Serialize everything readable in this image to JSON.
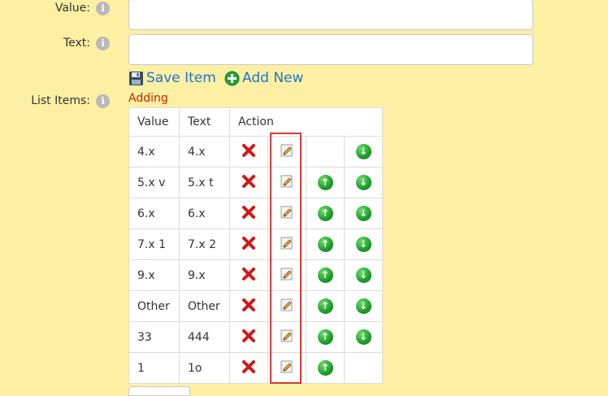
{
  "form": {
    "value_label": "Value:",
    "text_label": "Text:",
    "list_items_label": "List Items:",
    "info_glyph": "i",
    "value_input": "",
    "text_input": ""
  },
  "actions": {
    "save_item": "Save Item",
    "add_new": "Add New"
  },
  "status": "Adding",
  "table": {
    "headers": [
      "Value",
      "Text",
      "Action"
    ],
    "rows": [
      {
        "value": "4.x",
        "text": "4.x",
        "up": false,
        "down": true
      },
      {
        "value": "5.x v",
        "text": "5.x t",
        "up": true,
        "down": true
      },
      {
        "value": "6.x",
        "text": "6.x",
        "up": true,
        "down": true
      },
      {
        "value": "7.x 1",
        "text": "7.x 2",
        "up": true,
        "down": true
      },
      {
        "value": "9.x",
        "text": "9.x",
        "up": true,
        "down": true
      },
      {
        "value": "Other",
        "text": "Other",
        "up": true,
        "down": true
      },
      {
        "value": "33",
        "text": "444",
        "up": true,
        "down": true
      },
      {
        "value": "1",
        "text": "1o",
        "up": true,
        "down": false
      }
    ]
  },
  "colors": {
    "background": "#fdf0a3",
    "link": "#1f74d0",
    "status": "#cc2200",
    "highlight": "#d33a3a"
  },
  "icons": {
    "delete": "delete-icon",
    "edit": "edit-icon",
    "up": "move-up-icon",
    "down": "move-down-icon",
    "save": "floppy-disk-icon",
    "add": "add-icon",
    "info": "info-icon"
  }
}
